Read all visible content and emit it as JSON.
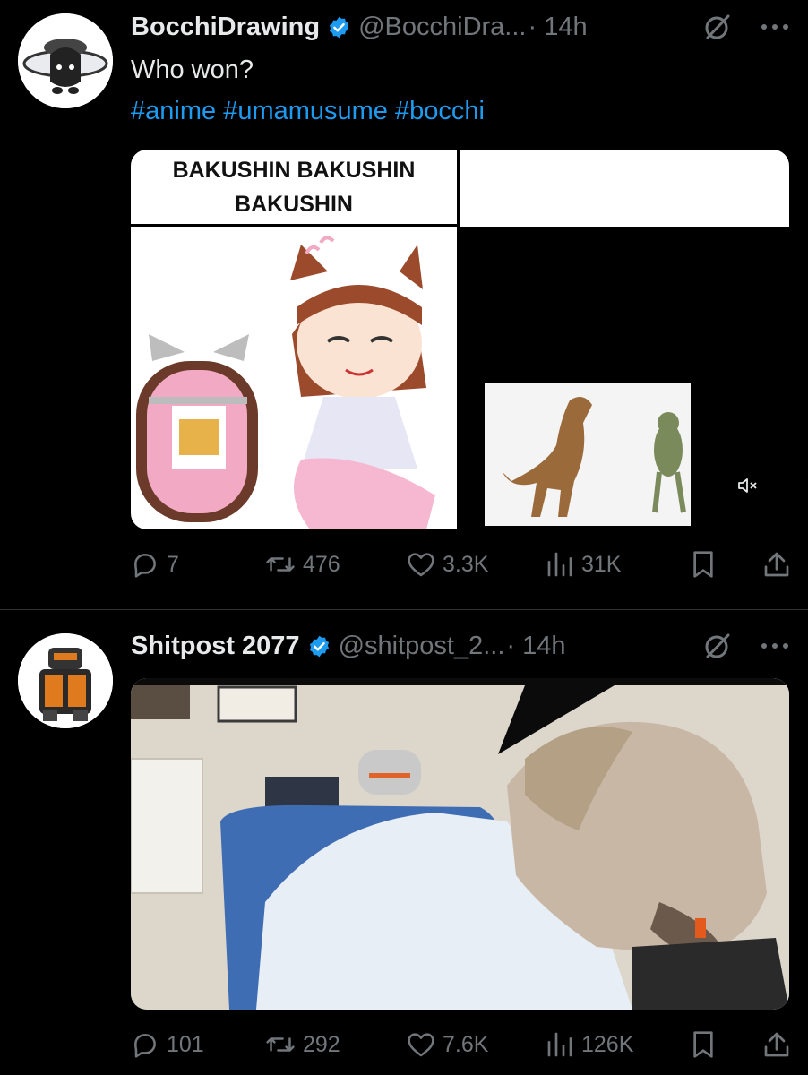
{
  "tweets": [
    {
      "author": "BocchiDrawing",
      "handle": "@BocchiDra...",
      "time": "· 14h",
      "text": "Who won?",
      "hashtags": [
        "#anime",
        "#umamusume",
        "#bocchi"
      ],
      "media": {
        "caption": "BAKUSHIN BAKUSHIN BAKUSHIN",
        "muted_icon": "speaker-muted-icon"
      },
      "stats": {
        "replies": "7",
        "reposts": "476",
        "likes": "3.3K",
        "views": "31K"
      }
    },
    {
      "author": "Shitpost 2077",
      "handle": "@shitpost_2...",
      "time": "· 14h",
      "stats": {
        "replies": "101",
        "reposts": "292",
        "likes": "7.6K",
        "views": "126K"
      }
    }
  ],
  "colors": {
    "background": "#000000",
    "text": "#e7e9ea",
    "muted": "#71767b",
    "link": "#1d9bf0",
    "verified": "#1d9bf0"
  },
  "icons": [
    "reply-icon",
    "repost-icon",
    "like-icon",
    "views-icon",
    "bookmark-icon",
    "share-icon",
    "grok-icon",
    "more-icon",
    "verified-badge-icon"
  ]
}
